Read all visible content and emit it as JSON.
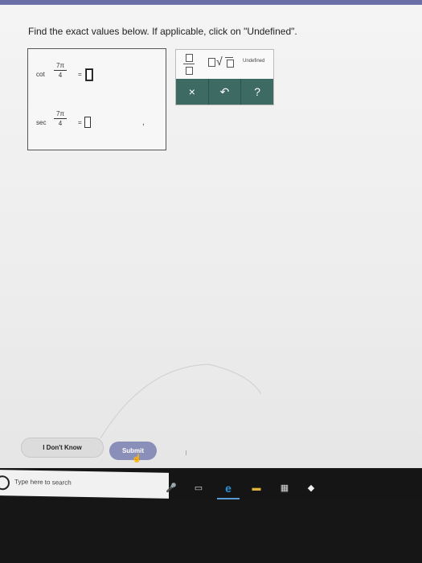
{
  "instruction": "Find the exact values below. If applicable, click on \"Undefined\".",
  "question": {
    "cot": {
      "fn": "cot",
      "numerator": "7π",
      "denominator": "4",
      "equals": "="
    },
    "sec": {
      "fn": "sec",
      "numerator": "7π",
      "denominator": "4",
      "equals": "=",
      "separator": ","
    }
  },
  "palette": {
    "undefined_label": "Undefined",
    "clear_symbol": "×",
    "undo_symbol": "↶",
    "help_symbol": "?"
  },
  "buttons": {
    "dont_know": "I Don't Know",
    "submit": "Submit"
  },
  "taskbar": {
    "search_placeholder": "Type here to search"
  },
  "colors": {
    "palette_dark": "#3d6b63",
    "submit": "#8a8fb9",
    "topbar": "#6a6fa8"
  }
}
